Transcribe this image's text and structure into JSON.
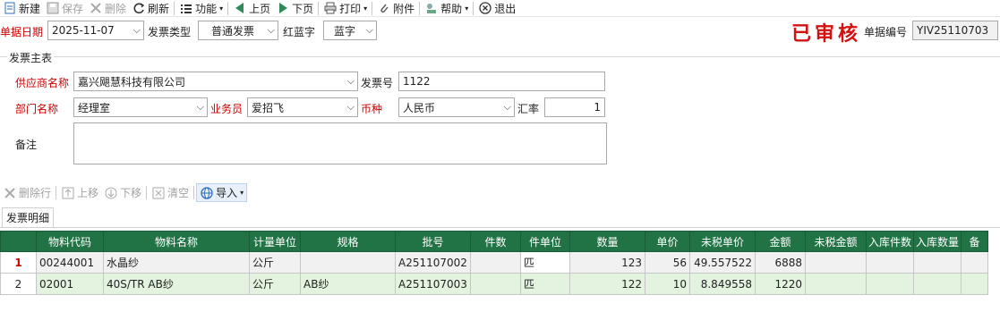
{
  "toolbar": {
    "items": [
      {
        "label": "新建",
        "icon": "new-doc-icon"
      },
      {
        "label": "保存",
        "icon": "save-icon"
      },
      {
        "label": "删除",
        "icon": "delete-icon"
      },
      {
        "label": "刷新",
        "icon": "refresh-icon"
      },
      {
        "label": "功能",
        "icon": "function-icon"
      },
      {
        "label": "上页",
        "icon": "prev-page-icon"
      },
      {
        "label": "下页",
        "icon": "next-page-icon"
      },
      {
        "label": "打印",
        "icon": "print-icon"
      },
      {
        "label": "附件",
        "icon": "attachment-icon"
      },
      {
        "label": "帮助",
        "icon": "help-icon"
      },
      {
        "label": "退出",
        "icon": "exit-icon"
      }
    ]
  },
  "header": {
    "date_label": "单据日期",
    "date_value": "2025-11-07",
    "invoice_type_label": "发票类型",
    "invoice_type_value": "普通发票",
    "red_blue_label": "红蓝字",
    "red_blue_value": "蓝字",
    "stamp": "已审核",
    "doc_no_label": "单据编号",
    "doc_no_value": "YIV25110703"
  },
  "main": {
    "group_title": "发票主表",
    "supplier_label": "供应商名称",
    "supplier_value": "嘉兴飓慧科技有限公司",
    "invoice_no_label": "发票号",
    "invoice_no_value": "1122",
    "dept_label": "部门名称",
    "dept_value": "经理室",
    "salesman_label": "业务员",
    "salesman_value": "爱招飞",
    "currency_label": "币种",
    "currency_value": "人民币",
    "rate_label": "汇率",
    "rate_value": "1",
    "remark_label": "备注",
    "remark_value": ""
  },
  "subtoolbar": {
    "delete_row": "删除行",
    "move_up": "上移",
    "move_down": "下移",
    "clear": "清空",
    "import": "导入"
  },
  "detail_tab": "发票明细",
  "grid": {
    "columns": [
      "物料代码",
      "物料名称",
      "计量单位",
      "规格",
      "批号",
      "件数",
      "件单位",
      "数量",
      "单价",
      "未税单价",
      "金额",
      "未税金额",
      "入库件数",
      "入库数量",
      "备"
    ],
    "rows": [
      {
        "no": "1",
        "cells": [
          "00244001",
          "水晶纱",
          "公斤",
          "",
          "A251107002",
          "",
          "匹",
          "123",
          "56",
          "49.557522",
          "6888",
          "",
          "",
          "",
          ""
        ]
      },
      {
        "no": "2",
        "cells": [
          "02001",
          "40S/TR AB纱",
          "公斤",
          "AB纱",
          "A251107003",
          "",
          "匹",
          "122",
          "10",
          "8.849558",
          "1220",
          "",
          "",
          "",
          ""
        ]
      }
    ]
  },
  "colors": {
    "grid_header": "#217346",
    "label_red": "#cc0000",
    "row_alt": "#e3f3df"
  }
}
